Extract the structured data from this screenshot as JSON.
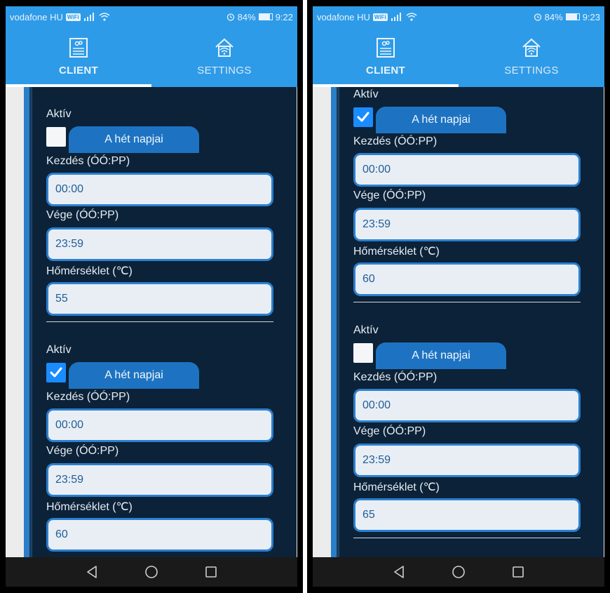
{
  "status_bar": {
    "carrier": "vodafone HU",
    "carrier_badge": "WiFi",
    "battery_level": 0.84
  },
  "screenshots": [
    {
      "status_bar": {
        "battery": "84%",
        "time": "9:22"
      },
      "tabs": [
        {
          "label": "CLIENT",
          "icon": "client-icon",
          "active": true
        },
        {
          "label": "SETTINGS",
          "icon": "settings-icon",
          "active": false
        }
      ],
      "schedules": [
        {
          "active_label": "Aktív",
          "active": false,
          "days_button": "A hét napjai",
          "start_label": "Kezdés (ÓÓ:PP)",
          "start_value": "00:00",
          "end_label": "Vége (ÓÓ:PP)",
          "end_value": "23:59",
          "temp_label": "Hőmérséklet (℃)",
          "temp_value": "55"
        },
        {
          "active_label": "Aktív",
          "active": true,
          "days_button": "A hét napjai",
          "start_label": "Kezdés (ÓÓ:PP)",
          "start_value": "00:00",
          "end_label": "Vége (ÓÓ:PP)",
          "end_value": "23:59",
          "temp_label": "Hőmérséklet (℃)",
          "temp_value": "60"
        }
      ]
    },
    {
      "status_bar": {
        "battery": "84%",
        "time": "9:23"
      },
      "tabs": [
        {
          "label": "CLIENT",
          "icon": "client-icon",
          "active": true
        },
        {
          "label": "SETTINGS",
          "icon": "settings-icon",
          "active": false
        }
      ],
      "schedules": [
        {
          "active_label": "Aktív",
          "active": true,
          "days_button": "A hét napjai",
          "start_label": "Kezdés (ÓÓ:PP)",
          "start_value": "00:00",
          "end_label": "Vége (ÓÓ:PP)",
          "end_value": "23:59",
          "temp_label": "Hőmérséklet (℃)",
          "temp_value": "60"
        },
        {
          "active_label": "Aktív",
          "active": false,
          "days_button": "A hét napjai",
          "start_label": "Kezdés (ÓÓ:PP)",
          "start_value": "00:00",
          "end_label": "Vége (ÓÓ:PP)",
          "end_value": "23:59",
          "temp_label": "Hőmérséklet (℃)",
          "temp_value": "65"
        }
      ]
    }
  ],
  "nav_bar": {
    "back_icon": "back-triangle-icon",
    "home_icon": "home-circle-icon",
    "recents_icon": "recents-square-icon"
  },
  "colors": {
    "accent": "#2e9be8",
    "panel": "#0c2238",
    "field_border": "#2a80d0",
    "checkbox_checked": "#1a8cff"
  }
}
